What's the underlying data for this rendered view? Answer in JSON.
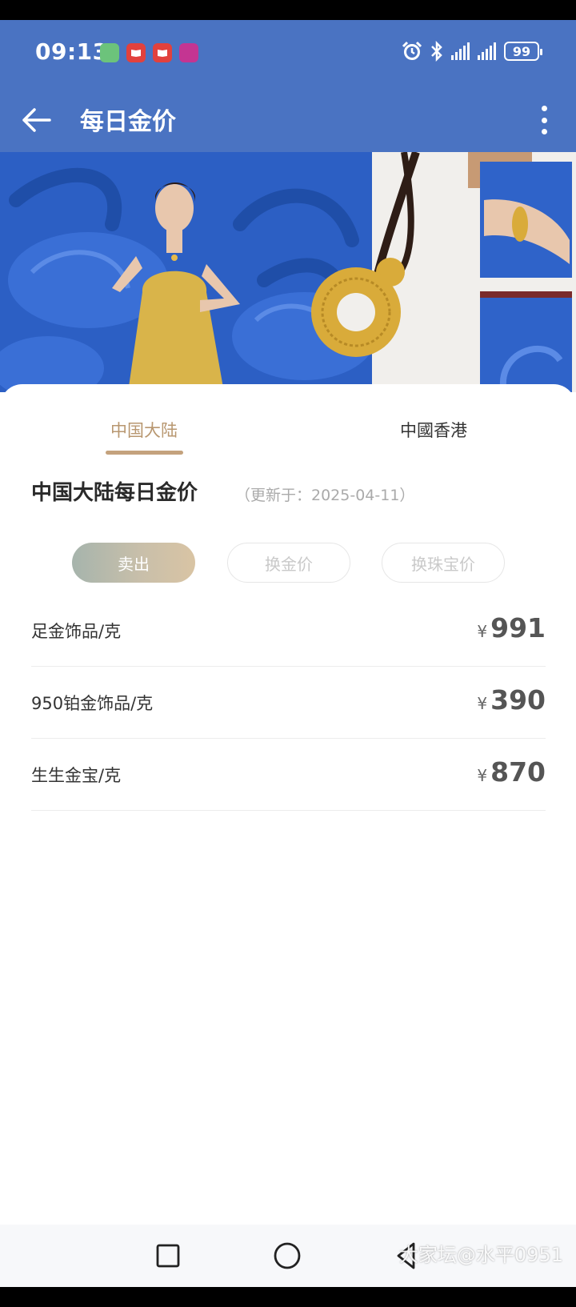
{
  "status_bar": {
    "time": "09:13",
    "battery": "99",
    "app_icons": [
      {
        "name": "green-app-icon",
        "color": "#6cc37b"
      },
      {
        "name": "red-book-app-icon",
        "color": "#e2413d"
      },
      {
        "name": "red-book-app-icon-2",
        "color": "#e2413d"
      },
      {
        "name": "pink-app-icon",
        "color": "#c43592"
      }
    ]
  },
  "app_bar": {
    "title": "每日金价",
    "background_color": "#4a73c2"
  },
  "region_tabs": [
    {
      "label": "中国大陆",
      "active": true
    },
    {
      "label": "中國香港",
      "active": false
    }
  ],
  "section": {
    "title": "中国大陆每日金价",
    "updated": "（更新于：2025-04-11）"
  },
  "price_types": [
    {
      "label": "卖出",
      "active": true
    },
    {
      "label": "换金价",
      "active": false
    },
    {
      "label": "换珠宝价",
      "active": false
    }
  ],
  "prices": [
    {
      "name": "足金饰品/克",
      "currency": "¥",
      "value": "991"
    },
    {
      "name": "950铂金饰品/克",
      "currency": "¥",
      "value": "390"
    },
    {
      "name": "生生金宝/克",
      "currency": "¥",
      "value": "870"
    }
  ],
  "watermark": "大家坛@水平0951",
  "colors": {
    "accent_gold": "#c4a27d",
    "tab_active_text": "#b89770",
    "banner_blue": "#2c5fc4"
  }
}
